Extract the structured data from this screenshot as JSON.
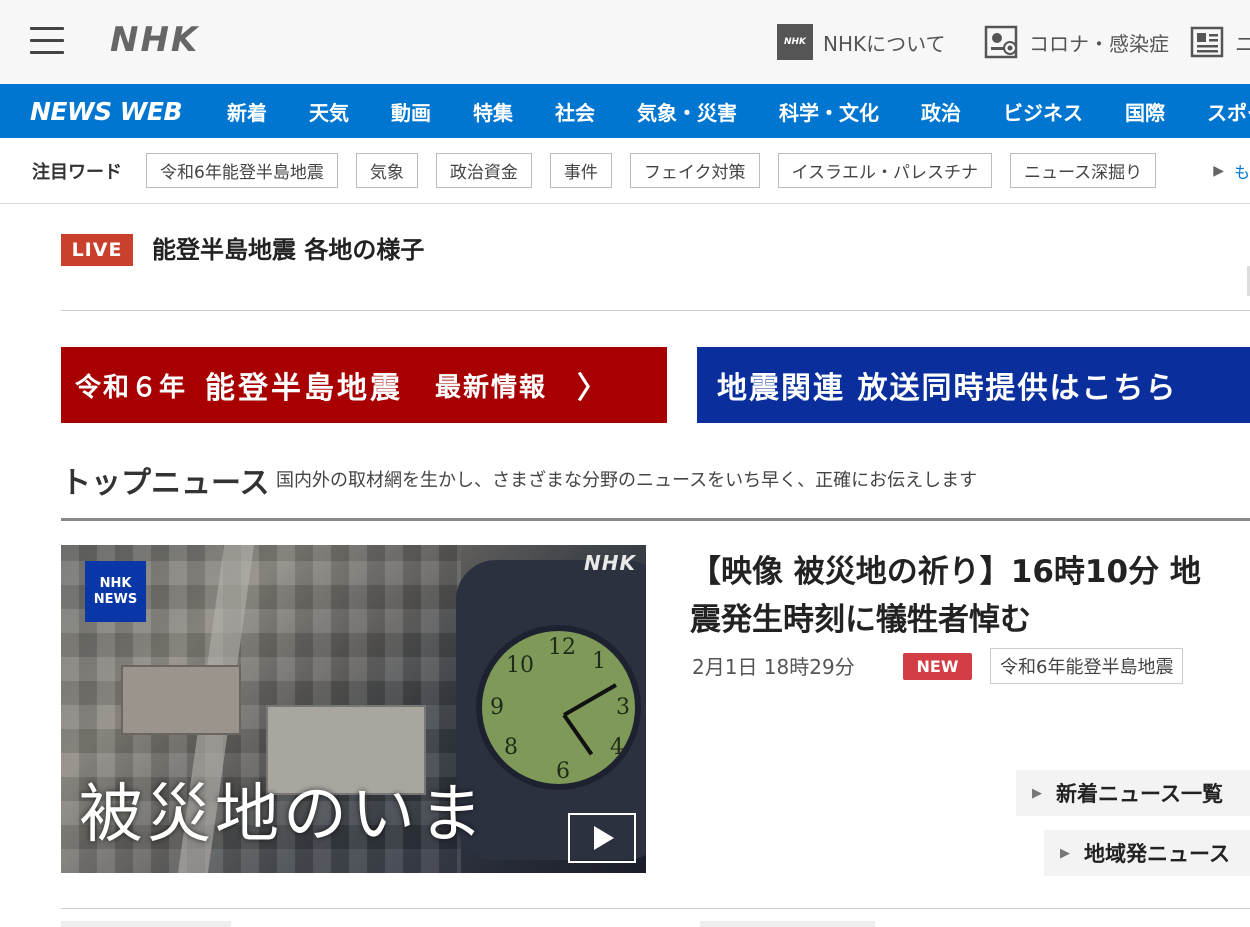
{
  "header": {
    "logo": "NHK",
    "links": [
      {
        "label": "NHKについて",
        "icon": "nhk-icon",
        "icon_text": "NHK"
      },
      {
        "label": "コロナ・感染症",
        "icon": "virus-icon"
      },
      {
        "label": "ニ",
        "icon": "news-icon"
      }
    ]
  },
  "nav": {
    "brand": "NEWS WEB",
    "items": [
      "新着",
      "天気",
      "動画",
      "特集",
      "社会",
      "気象・災害",
      "科学・文化",
      "政治",
      "ビジネス",
      "国際",
      "スポーツ"
    ]
  },
  "trending": {
    "label": "注目ワード",
    "chips": [
      "令和6年能登半島地震",
      "気象",
      "政治資金",
      "事件",
      "フェイク対策",
      "イスラエル・パレスチナ",
      "ニュース深掘り"
    ],
    "more": "も"
  },
  "live": {
    "badge": "LIVE",
    "title": "能登半島地震 各地の様子"
  },
  "banners": {
    "red": {
      "year": "令和６年",
      "name": "能登半島地震",
      "suffix": "最新情報",
      "chevron": "〉"
    },
    "blue": {
      "text": "地震関連 放送同時提供はこちら"
    }
  },
  "top_news": {
    "heading": "トップニュース",
    "subtitle": "国内外の取材網を生かし、さまざまな分野のニュースをいち早く、正確にお伝えします"
  },
  "hero": {
    "watermark": "NHK",
    "badge_line1": "NHK",
    "badge_line2": "NEWS",
    "caption": "被災地のいま"
  },
  "article": {
    "title_line1": "【映像 被災地の祈り】16時10分 地",
    "title_line2": "震発生時刻に犠牲者悼む",
    "date": "2月1日 18時29分",
    "new_badge": "NEW",
    "tag": "令和6年能登半島地震"
  },
  "side_links": [
    "新着ニュース一覧",
    "地域発ニュース"
  ],
  "colors": {
    "nav_blue": "#0076d1",
    "live_red": "#c9412c",
    "banner_red": "#a80000",
    "banner_blue": "#0a2f9c",
    "new_badge": "#d23d46"
  }
}
